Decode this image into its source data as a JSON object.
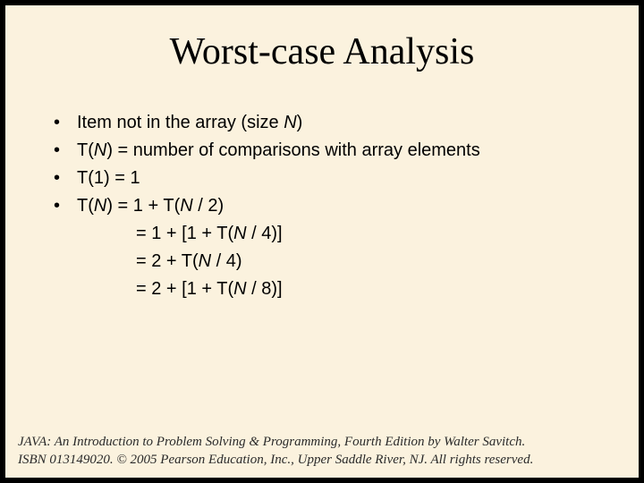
{
  "title": "Worst-case Analysis",
  "bullets": {
    "b1_pre": "Item not in the array (size ",
    "b1_var": "N",
    "b1_post": ")",
    "b2_pre": "T(",
    "b2_var": "N",
    "b2_post": ") = number of comparisons with array elements",
    "b3": "T(1) = 1",
    "b4_pre": "T(",
    "b4_var": "N",
    "b4_mid1": ") = 1 + T(",
    "b4_var2": "N",
    "b4_mid2": " / 2)"
  },
  "cont": {
    "l1_pre": "= 1 + [1 + T(",
    "l1_var": "N",
    "l1_post": " / 4)]",
    "l2_pre": "= 2 + T(",
    "l2_var": "N",
    "l2_post": " / 4)",
    "l3_pre": "= 2 + [1 + T(",
    "l3_var": "N",
    "l3_post": " / 8)]"
  },
  "footer": {
    "line1a": "JAVA: An Introduction to Problem Solving & Programming",
    "line1b": ", Fourth Edition by Walter Savitch.",
    "line2": "ISBN 013149020. © 2005 Pearson Education, Inc., Upper Saddle River, NJ. All rights reserved."
  }
}
